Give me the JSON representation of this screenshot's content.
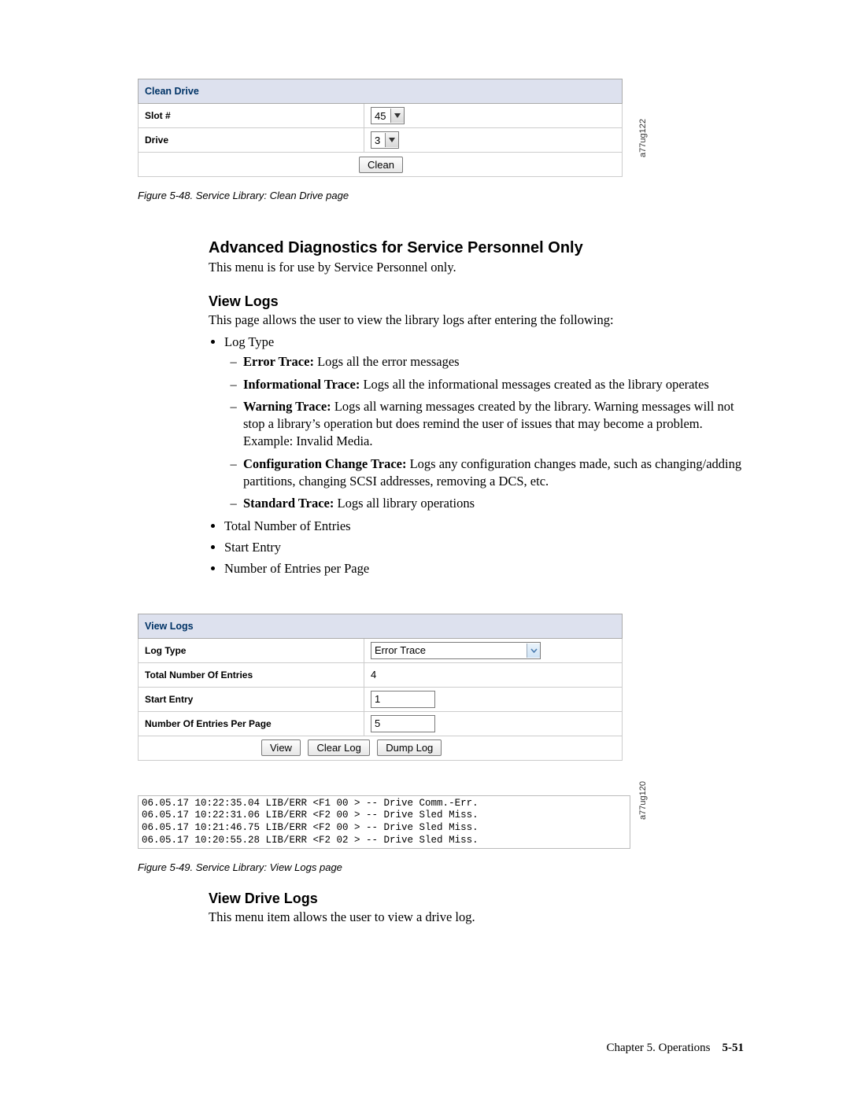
{
  "clean_drive": {
    "title": "Clean Drive",
    "rows": {
      "slot_label": "Slot #",
      "slot_value": "45",
      "drive_label": "Drive",
      "drive_value": "3"
    },
    "clean_btn": "Clean",
    "sidecode": "a77ug122"
  },
  "caption1": "Figure 5-48. Service Library: Clean Drive page",
  "sect_adv": {
    "title": "Advanced Diagnostics for Service Personnel Only",
    "body": "This menu is for use by Service Personnel only."
  },
  "sect_viewlogs": {
    "title": "View Logs",
    "body": "This page allows the user to view the library logs after entering the following:",
    "li_logtype": "Log Type",
    "li_errtrace_b": "Error Trace:",
    "li_errtrace_t": " Logs all the error messages",
    "li_info_b": "Informational Trace:",
    "li_info_t": " Logs all the informational messages created as the library operates",
    "li_warn_b": "Warning Trace:",
    "li_warn_t": " Logs all warning messages created by the library. Warning messages will not stop a library’s operation but does remind the user of issues that may become a problem. Example: Invalid Media.",
    "li_cfg_b": "Configuration Change Trace:",
    "li_cfg_t": " Logs any configuration changes made, such as changing/adding partitions, changing SCSI addresses, removing a DCS, etc.",
    "li_std_b": "Standard Trace:",
    "li_std_t": " Logs all library operations",
    "li_total": "Total Number of Entries",
    "li_start": "Start Entry",
    "li_perpage": "Number of Entries per Page"
  },
  "view_logs_ui": {
    "title": "View Logs",
    "logtype_label": "Log Type",
    "logtype_value": "Error Trace",
    "total_label": "Total Number Of Entries",
    "total_value": "4",
    "start_label": "Start Entry",
    "start_value": "1",
    "perpage_label": "Number Of Entries Per Page",
    "perpage_value": "5",
    "btn_view": "View",
    "btn_clear": "Clear Log",
    "btn_dump": "Dump Log",
    "sidecode": "a77ug120"
  },
  "log_lines": {
    "l0": "06.05.17 10:22:35.04 LIB/ERR <F1 00 > -- Drive Comm.-Err.",
    "l1": "06.05.17 10:22:31.06 LIB/ERR <F2 00 > -- Drive Sled Miss.",
    "l2": "06.05.17 10:21:46.75 LIB/ERR <F2 00 > -- Drive Sled Miss.",
    "l3": "06.05.17 10:20:55.28 LIB/ERR <F2 02 > -- Drive Sled Miss."
  },
  "caption2": "Figure 5-49. Service Library: View Logs page",
  "sect_drivelogs": {
    "title": "View Drive Logs",
    "body": "This menu item allows the user to view a drive log."
  },
  "footer": {
    "chapter": "Chapter 5. Operations",
    "page": "5-51"
  }
}
